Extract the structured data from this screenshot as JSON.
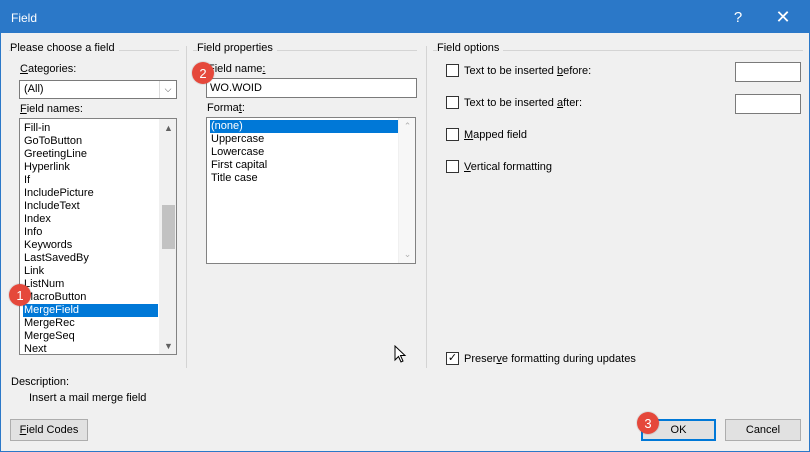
{
  "window": {
    "title": "Field",
    "help_glyph": "?",
    "close_glyph": "✕"
  },
  "left": {
    "group_label": "Please choose a field",
    "categories_label": "Categories:",
    "categories_value": "(All)",
    "field_names_label": "Field names:",
    "items": [
      "Fill-in",
      "GoToButton",
      "GreetingLine",
      "Hyperlink",
      "If",
      "IncludePicture",
      "IncludeText",
      "Index",
      "Info",
      "Keywords",
      "LastSavedBy",
      "Link",
      "ListNum",
      "MacroButton",
      "MergeField",
      "MergeRec",
      "MergeSeq",
      "Next"
    ],
    "selected_index": 14,
    "description_label": "Description:",
    "description_text": "Insert a mail merge field",
    "field_codes_button": "Field Codes"
  },
  "middle": {
    "group_label": "Field properties",
    "field_name_label": "Field name:",
    "field_name_value": "WO.WOID",
    "format_label": "Format:",
    "format_items": [
      "(none)",
      "Uppercase",
      "Lowercase",
      "First capital",
      "Title case"
    ],
    "selected_index": 0
  },
  "right": {
    "group_label": "Field options",
    "text_before_label": "Text to be inserted before:",
    "text_after_label": "Text to be inserted after:",
    "mapped_field_label": "Mapped field",
    "vertical_formatting_label": "Vertical formatting",
    "preserve_label": "Preserve formatting during updates",
    "preserve_checked": "✓",
    "ok_button": "OK",
    "cancel_button": "Cancel"
  },
  "badges": {
    "one": "1",
    "two": "2",
    "three": "3"
  },
  "colors": {
    "titlebar": "#2b78c8",
    "selection": "#0078d7",
    "badge": "#e5483b"
  }
}
